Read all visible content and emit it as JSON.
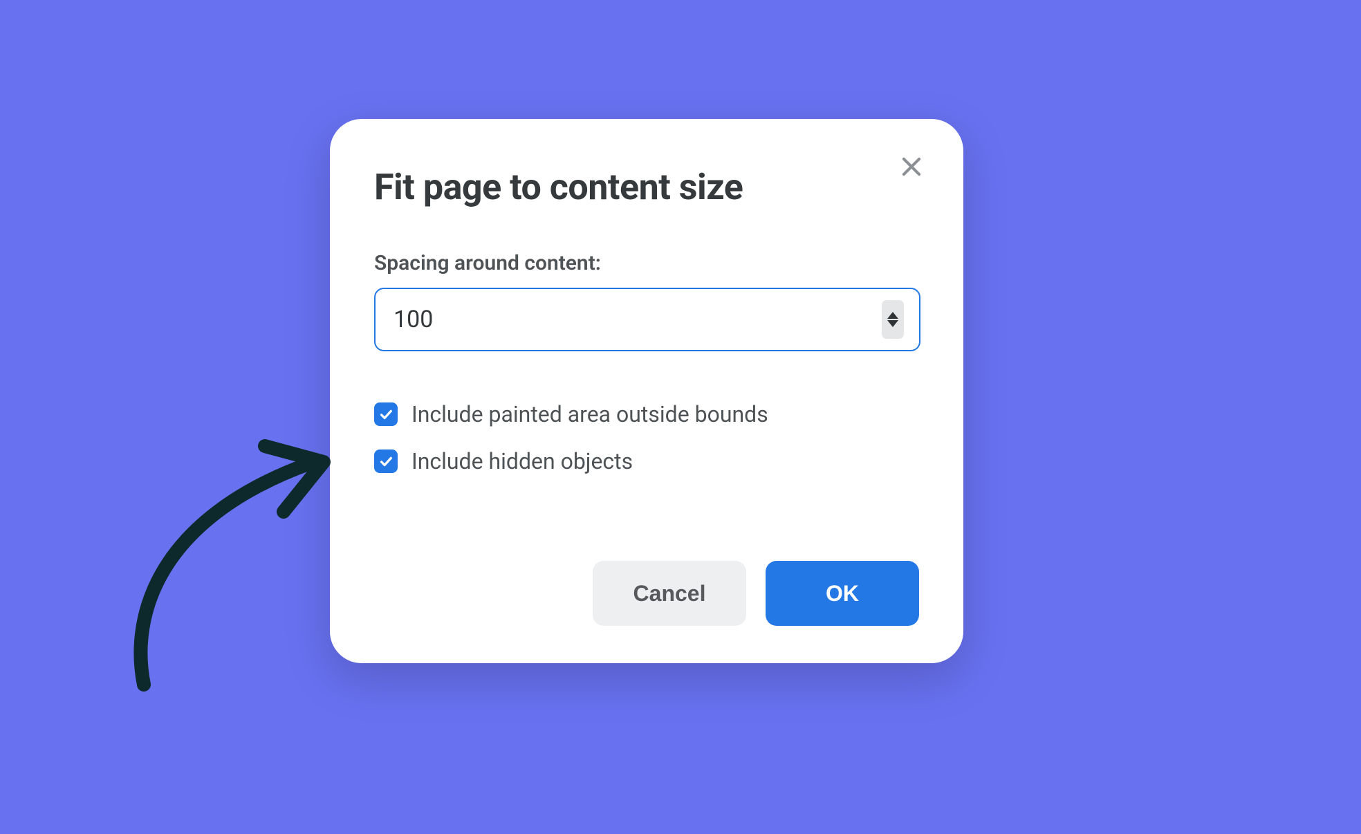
{
  "dialog": {
    "title": "Fit page to content size",
    "spacing_label": "Spacing around content:",
    "spacing_value": "100",
    "option_painted_area": "Include painted area outside bounds",
    "option_hidden_objects": "Include hidden objects",
    "cancel_label": "Cancel",
    "ok_label": "OK"
  },
  "colors": {
    "background": "#6871F0",
    "primary": "#2378E5",
    "text_dark": "#363A3D"
  }
}
